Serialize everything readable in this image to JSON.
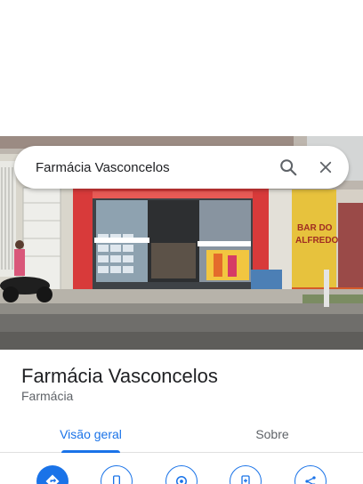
{
  "search": {
    "query": "Farmácia Vasconcelos"
  },
  "photo": {
    "shop_sign": "BAR DO\nALFREDO"
  },
  "place": {
    "name": "Farmácia Vasconcelos",
    "category": "Farmácia"
  },
  "tabs": [
    {
      "label": "Visão geral",
      "active": true
    },
    {
      "label": "Sobre",
      "active": false
    }
  ],
  "actions": [
    {
      "icon": "directions-icon"
    },
    {
      "icon": "phone-icon"
    },
    {
      "icon": "location-pin-icon"
    },
    {
      "icon": "save-icon"
    },
    {
      "icon": "share-icon"
    }
  ],
  "colors": {
    "accent": "#1a73e8",
    "text": "#202124",
    "muted": "#5f6368"
  }
}
